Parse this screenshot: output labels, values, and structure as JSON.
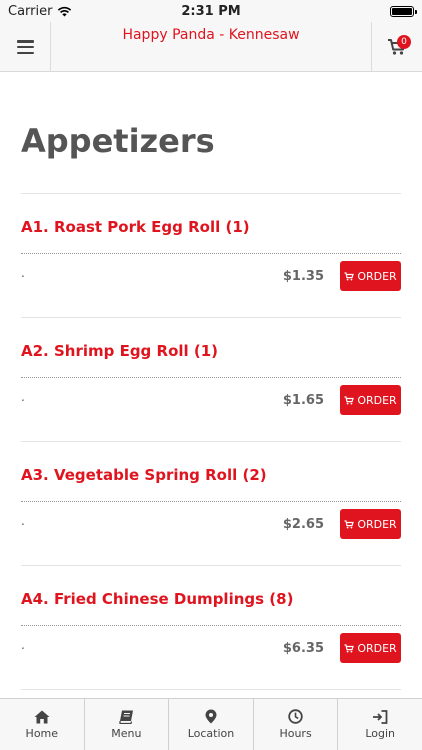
{
  "status_bar": {
    "carrier": "Carrier",
    "time": "2:31 PM"
  },
  "header": {
    "title": "Happy Panda - Kennesaw",
    "cart_count": "0"
  },
  "page": {
    "title": "Appetizers"
  },
  "items": [
    {
      "name": "A1. Roast Pork Egg Roll (1)",
      "description": ".",
      "price": "$1.35",
      "order_label": "ORDER"
    },
    {
      "name": "A2. Shrimp Egg Roll (1)",
      "description": ".",
      "price": "$1.65",
      "order_label": "ORDER"
    },
    {
      "name": "A3. Vegetable Spring Roll (2)",
      "description": ".",
      "price": "$2.65",
      "order_label": "ORDER"
    },
    {
      "name": "A4. Fried Chinese Dumplings (8)",
      "description": ".",
      "price": "$6.35",
      "order_label": "ORDER"
    }
  ],
  "tabs": [
    {
      "label": "Home",
      "icon": "home-icon"
    },
    {
      "label": "Menu",
      "icon": "book-icon"
    },
    {
      "label": "Location",
      "icon": "map-pin-icon"
    },
    {
      "label": "Hours",
      "icon": "clock-icon"
    },
    {
      "label": "Login",
      "icon": "login-icon"
    }
  ],
  "colors": {
    "accent": "#e0141e",
    "header_bg": "#f7f7f7",
    "title_text": "#555555",
    "price_text": "#666666"
  }
}
